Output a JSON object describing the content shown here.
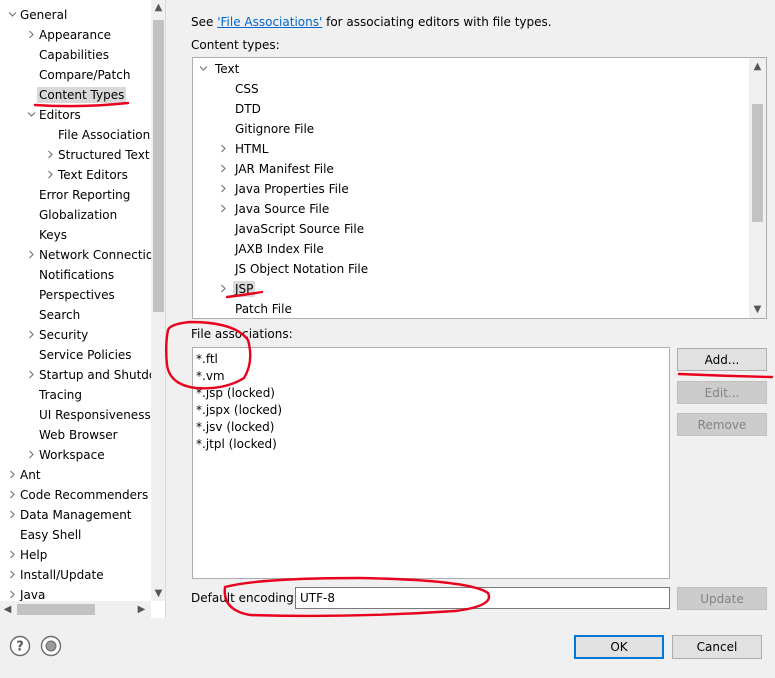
{
  "tree": {
    "items": [
      {
        "label": "General",
        "depth": 0,
        "arrow": "expanded"
      },
      {
        "label": "Appearance",
        "depth": 1,
        "arrow": "collapsed"
      },
      {
        "label": "Capabilities",
        "depth": 1,
        "arrow": "none"
      },
      {
        "label": "Compare/Patch",
        "depth": 1,
        "arrow": "none"
      },
      {
        "label": "Content Types",
        "depth": 1,
        "arrow": "none",
        "selected": true
      },
      {
        "label": "Editors",
        "depth": 1,
        "arrow": "expanded"
      },
      {
        "label": "File Associations",
        "depth": 2,
        "arrow": "none"
      },
      {
        "label": "Structured Text",
        "depth": 2,
        "arrow": "collapsed"
      },
      {
        "label": "Text Editors",
        "depth": 2,
        "arrow": "collapsed"
      },
      {
        "label": "Error Reporting",
        "depth": 1,
        "arrow": "none"
      },
      {
        "label": "Globalization",
        "depth": 1,
        "arrow": "none"
      },
      {
        "label": "Keys",
        "depth": 1,
        "arrow": "none"
      },
      {
        "label": "Network Connections",
        "depth": 1,
        "arrow": "collapsed"
      },
      {
        "label": "Notifications",
        "depth": 1,
        "arrow": "none"
      },
      {
        "label": "Perspectives",
        "depth": 1,
        "arrow": "none"
      },
      {
        "label": "Search",
        "depth": 1,
        "arrow": "none"
      },
      {
        "label": "Security",
        "depth": 1,
        "arrow": "collapsed"
      },
      {
        "label": "Service Policies",
        "depth": 1,
        "arrow": "none"
      },
      {
        "label": "Startup and Shutdown",
        "depth": 1,
        "arrow": "collapsed"
      },
      {
        "label": "Tracing",
        "depth": 1,
        "arrow": "none"
      },
      {
        "label": "UI Responsiveness",
        "depth": 1,
        "arrow": "none"
      },
      {
        "label": "Web Browser",
        "depth": 1,
        "arrow": "none"
      },
      {
        "label": "Workspace",
        "depth": 1,
        "arrow": "collapsed"
      },
      {
        "label": "Ant",
        "depth": 0,
        "arrow": "collapsed"
      },
      {
        "label": "Code Recommenders",
        "depth": 0,
        "arrow": "collapsed"
      },
      {
        "label": "Data Management",
        "depth": 0,
        "arrow": "collapsed"
      },
      {
        "label": "Easy Shell",
        "depth": 0,
        "arrow": "none"
      },
      {
        "label": "Help",
        "depth": 0,
        "arrow": "collapsed"
      },
      {
        "label": "Install/Update",
        "depth": 0,
        "arrow": "collapsed"
      },
      {
        "label": "Java",
        "depth": 0,
        "arrow": "collapsed"
      }
    ]
  },
  "see": {
    "prefix": "See ",
    "link": "'File Associations'",
    "suffix": " for associating editors with file types."
  },
  "content_types": {
    "label": "Content types:",
    "items": [
      {
        "label": "Text",
        "depth": 0,
        "arrow": "expanded"
      },
      {
        "label": "CSS",
        "depth": 1,
        "arrow": "none"
      },
      {
        "label": "DTD",
        "depth": 1,
        "arrow": "none"
      },
      {
        "label": "Gitignore File",
        "depth": 1,
        "arrow": "none"
      },
      {
        "label": "HTML",
        "depth": 1,
        "arrow": "collapsed"
      },
      {
        "label": "JAR Manifest File",
        "depth": 1,
        "arrow": "collapsed"
      },
      {
        "label": "Java Properties File",
        "depth": 1,
        "arrow": "collapsed"
      },
      {
        "label": "Java Source File",
        "depth": 1,
        "arrow": "collapsed"
      },
      {
        "label": "JavaScript Source File",
        "depth": 1,
        "arrow": "none"
      },
      {
        "label": "JAXB Index File",
        "depth": 1,
        "arrow": "none"
      },
      {
        "label": "JS Object Notation File",
        "depth": 1,
        "arrow": "none"
      },
      {
        "label": "JSP",
        "depth": 1,
        "arrow": "collapsed",
        "selected": true
      },
      {
        "label": "Patch File",
        "depth": 1,
        "arrow": "none"
      }
    ]
  },
  "file_associations": {
    "label": "File associations:",
    "items": [
      "*.ftl",
      "*.vm",
      "*.jsp (locked)",
      "*.jspx (locked)",
      "*.jsv (locked)",
      "*.jtpl (locked)"
    ]
  },
  "buttons": {
    "add": "Add...",
    "edit": "Edit...",
    "remove": "Remove",
    "update": "Update",
    "ok": "OK",
    "cancel": "Cancel"
  },
  "encoding": {
    "label": "Default encoding:",
    "value": "UTF-8"
  },
  "icons": {
    "help": "help-icon",
    "import_export": "import-export-icon"
  },
  "colors": {
    "annotation": "#e8001c",
    "link": "#0066cc",
    "focus": "#0078d7"
  }
}
